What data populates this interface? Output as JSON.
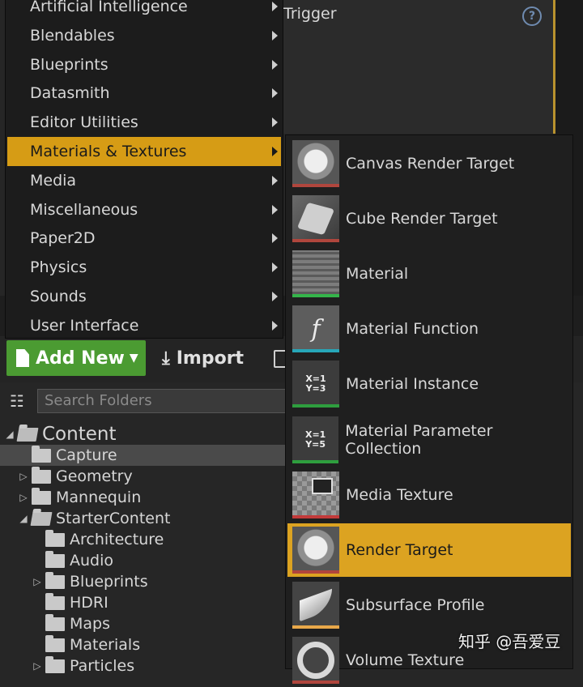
{
  "details_panel": {
    "trigger_label": "Trigger",
    "help_symbol": "?"
  },
  "toolbar": {
    "add_new_label": "Add New",
    "import_label": "Import"
  },
  "search": {
    "placeholder": "Search Folders"
  },
  "tree": [
    {
      "label": "Content",
      "expander": "◢",
      "level": 0,
      "open": true,
      "selected": false
    },
    {
      "label": "Capture",
      "expander": "",
      "level": 1,
      "open": false,
      "selected": true
    },
    {
      "label": "Geometry",
      "expander": "▷",
      "level": 1,
      "open": false,
      "selected": false
    },
    {
      "label": "Mannequin",
      "expander": "▷",
      "level": 1,
      "open": false,
      "selected": false
    },
    {
      "label": "StarterContent",
      "expander": "◢",
      "level": 1,
      "open": true,
      "selected": false
    },
    {
      "label": "Architecture",
      "expander": "",
      "level": 2,
      "open": false,
      "selected": false
    },
    {
      "label": "Audio",
      "expander": "",
      "level": 2,
      "open": false,
      "selected": false
    },
    {
      "label": "Blueprints",
      "expander": "▷",
      "level": 2,
      "open": false,
      "selected": false
    },
    {
      "label": "HDRI",
      "expander": "",
      "level": 2,
      "open": false,
      "selected": false
    },
    {
      "label": "Maps",
      "expander": "",
      "level": 2,
      "open": false,
      "selected": false
    },
    {
      "label": "Materials",
      "expander": "",
      "level": 2,
      "open": false,
      "selected": false
    },
    {
      "label": "Particles",
      "expander": "▷",
      "level": 2,
      "open": false,
      "selected": false
    }
  ],
  "category_menu": [
    {
      "label": "Artificial Intelligence",
      "highlighted": false
    },
    {
      "label": "Blendables",
      "highlighted": false
    },
    {
      "label": "Blueprints",
      "highlighted": false
    },
    {
      "label": "Datasmith",
      "highlighted": false
    },
    {
      "label": "Editor Utilities",
      "highlighted": false
    },
    {
      "label": "Materials & Textures",
      "highlighted": true
    },
    {
      "label": "Media",
      "highlighted": false
    },
    {
      "label": "Miscellaneous",
      "highlighted": false
    },
    {
      "label": "Paper2D",
      "highlighted": false
    },
    {
      "label": "Physics",
      "highlighted": false
    },
    {
      "label": "Sounds",
      "highlighted": false
    },
    {
      "label": "User Interface",
      "highlighted": false
    }
  ],
  "submenu": [
    {
      "label": "Canvas Render Target",
      "icon": "canvas-render-target-icon",
      "thumb": "t-canvas",
      "thumb_text": "",
      "bar_color": "#b0463d",
      "highlighted": false
    },
    {
      "label": "Cube Render Target",
      "icon": "cube-render-target-icon",
      "thumb": "t-cube",
      "thumb_text": "",
      "bar_color": "#b0463d",
      "highlighted": false
    },
    {
      "label": "Material",
      "icon": "material-icon",
      "thumb": "t-material",
      "thumb_text": "",
      "bar_color": "#34b44a",
      "highlighted": false
    },
    {
      "label": "Material Function",
      "icon": "material-function-icon",
      "thumb": "t-function",
      "thumb_text": "f",
      "bar_color": "#27a6b8",
      "highlighted": false
    },
    {
      "label": "Material Instance",
      "icon": "material-instance-icon",
      "thumb": "t-instance",
      "thumb_text": "X=1\nY=3",
      "bar_color": "#2e9e3e",
      "highlighted": false
    },
    {
      "label": "Material Parameter Collection",
      "icon": "material-parameter-collection-icon",
      "thumb": "t-collection",
      "thumb_text": "X=1\nY=5",
      "bar_color": "#2e9e3e",
      "highlighted": false
    },
    {
      "label": "Media Texture",
      "icon": "media-texture-icon",
      "thumb": "t-media",
      "thumb_text": "",
      "bar_color": "#c23a3a",
      "highlighted": false
    },
    {
      "label": "Render Target",
      "icon": "render-target-icon",
      "thumb": "t-canvas",
      "thumb_text": "",
      "bar_color": "#b0463d",
      "highlighted": true
    },
    {
      "label": "Subsurface Profile",
      "icon": "subsurface-profile-icon",
      "thumb": "t-subsurface",
      "thumb_text": "",
      "bar_color": "#e8a84a",
      "highlighted": false
    },
    {
      "label": "Volume Texture",
      "icon": "volume-texture-icon",
      "thumb": "t-volume",
      "thumb_text": "",
      "bar_color": "#b0463d",
      "highlighted": false
    }
  ],
  "watermark": "知乎 @吾爱豆",
  "colors": {
    "highlight": "#d69c15",
    "add_new_green": "#4b9b32",
    "background": "#262626"
  }
}
